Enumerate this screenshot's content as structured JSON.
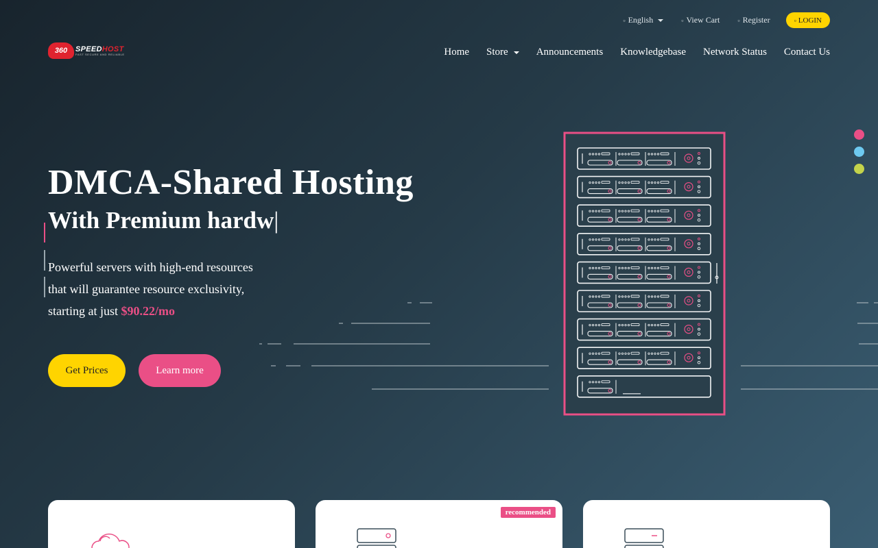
{
  "topbar": {
    "language": "English",
    "view_cart": "View Cart",
    "register": "Register",
    "login": "LOGIN"
  },
  "logo": {
    "badge": "360",
    "speed": "SPEED",
    "host": "HOST",
    "tagline": "FAST SECURE AND RELIABLE"
  },
  "nav": {
    "items": [
      "Home",
      "Store",
      "Announcements",
      "Knowledgebase",
      "Network Status",
      "Contact Us"
    ]
  },
  "hero": {
    "title": "DMCA-Shared Hosting",
    "subtitle": "With Premium hardw",
    "cursor": "|",
    "desc_line1": "Powerful servers with high-end resources",
    "desc_line2": "that will guarantee resource exclusivity,",
    "desc_line3": "starting at just",
    "price": "$90.22/mo",
    "btn_get_prices": "Get Prices",
    "btn_learn_more": "Learn more"
  },
  "cards": {
    "recommended": "recommended"
  },
  "colors": {
    "accent_pink": "#ea4f86",
    "accent_yellow": "#ffd400",
    "accent_blue": "#6dc9f0",
    "accent_green": "#c3d34b"
  }
}
